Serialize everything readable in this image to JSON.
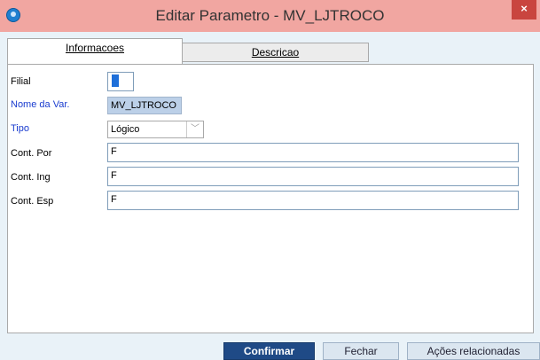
{
  "window": {
    "title": "Editar Parametro - MV_LJTROCO",
    "close": "×"
  },
  "tabs": [
    {
      "label": "Informacoes"
    },
    {
      "label": "Descricao"
    }
  ],
  "form": {
    "filial": {
      "label": "Filial",
      "value": ""
    },
    "nome_var": {
      "label": "Nome da Var.",
      "value": "MV_LJTROCO"
    },
    "tipo": {
      "label": "Tipo",
      "value": "Lógico",
      "arrow": "﹀"
    },
    "cont_por": {
      "label": "Cont. Por",
      "value": "F"
    },
    "cont_ing": {
      "label": "Cont. Ing",
      "value": "F"
    },
    "cont_esp": {
      "label": "Cont. Esp",
      "value": "F"
    }
  },
  "buttons": {
    "confirm": "Confirmar",
    "close": "Fechar",
    "actions": "Ações relacionadas"
  },
  "colors": {
    "titlebar": "#f1a6a1",
    "confirm": "#1f4a86",
    "label_blue": "#1a3ccf"
  }
}
